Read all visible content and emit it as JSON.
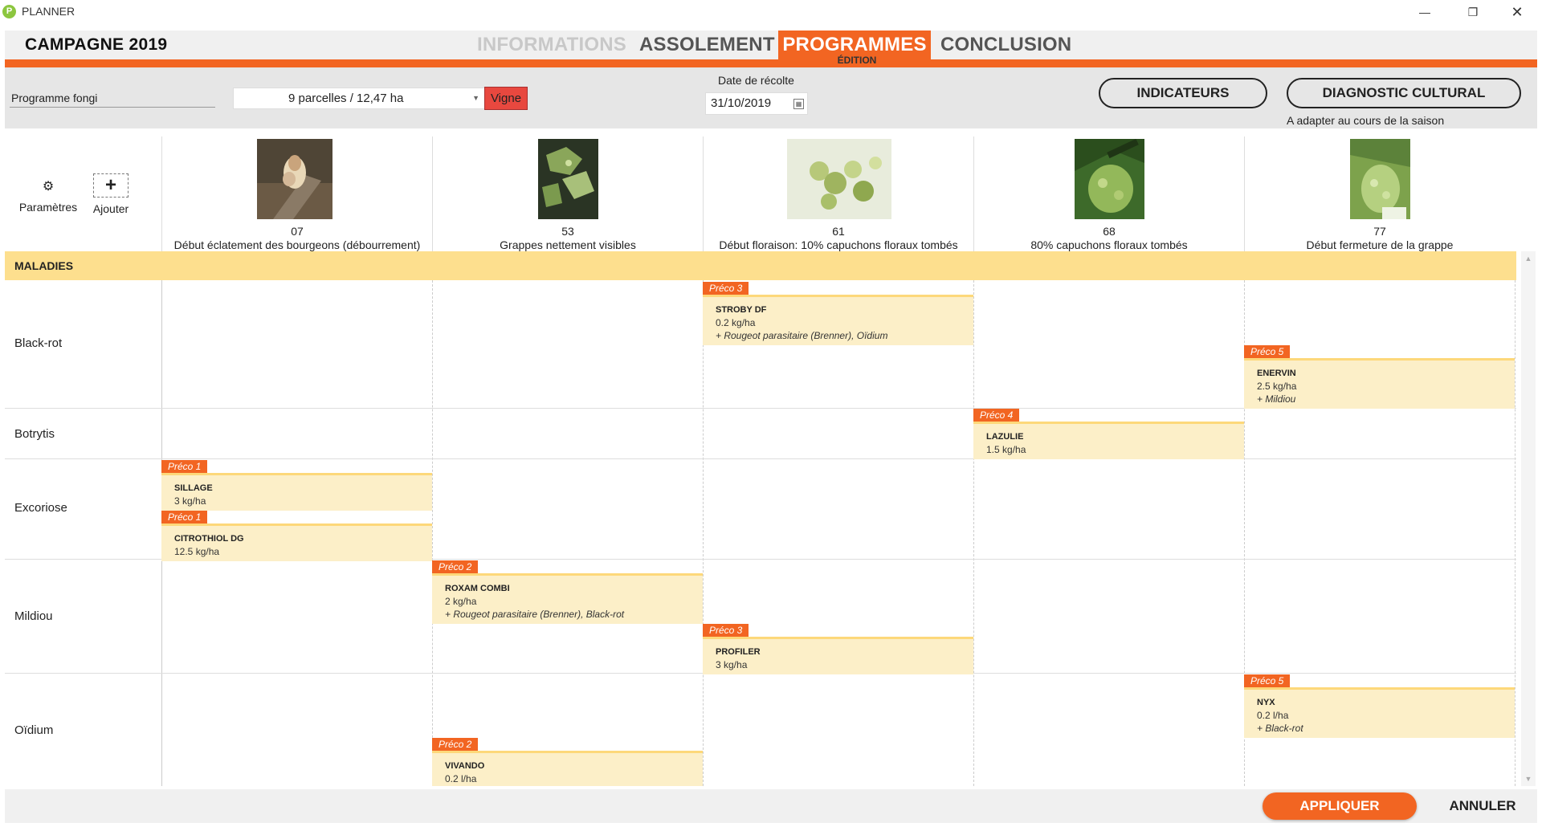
{
  "window": {
    "title": "PLANNER",
    "logo_letter": "P",
    "minimize": "—",
    "maximize": "❐",
    "close": "✕"
  },
  "header": {
    "campaign": "CAMPAGNE  2019",
    "tabs": [
      "INFORMATIONS",
      "ASSOLEMENT",
      "PROGRAMMES",
      "CONCLUSION"
    ],
    "active_tab": "PROGRAMMES",
    "subtitle": "ÉDITION"
  },
  "toolbar": {
    "program_name": "Programme fongi",
    "parcels": "9 parcelles  /  12,47   ha",
    "crop": "Vigne",
    "harvest_label": "Date de récolte",
    "harvest_date": "31/10/2019",
    "indicators_btn": "INDICATEURS",
    "diagnostic_btn": "DIAGNOSTIC CULTURAL",
    "season_note": "A adapter au cours de la saison"
  },
  "tools": {
    "params": "Paramètres",
    "add": "Ajouter"
  },
  "stages": [
    {
      "code": "07",
      "name": "Début éclatement des bourgeons (débourrement)"
    },
    {
      "code": "53",
      "name": "Grappes nettement visibles"
    },
    {
      "code": "61",
      "name": "Début floraison: 10% capuchons floraux tombés"
    },
    {
      "code": "68",
      "name": "80% capuchons floraux tombés"
    },
    {
      "code": "77",
      "name": "Début fermeture de la grappe"
    }
  ],
  "section": "MALADIES",
  "diseases": [
    "Black-rot",
    "Botrytis",
    "Excoriose",
    "Mildiou",
    "Oïdium"
  ],
  "treatments": [
    {
      "preco": "Préco 3",
      "name": "STROBY DF",
      "dose": "0.2 kg/ha",
      "extra": "+ Rougeot parasitaire (Brenner), Oïdium"
    },
    {
      "preco": "Préco 5",
      "name": "ENERVIN",
      "dose": "2.5 kg/ha",
      "extra": "+ Mildiou"
    },
    {
      "preco": "Préco 4",
      "name": "LAZULIE",
      "dose": "1.5 kg/ha",
      "extra": ""
    },
    {
      "preco": "Préco 1",
      "name": "SILLAGE",
      "dose": "3 kg/ha",
      "extra": ""
    },
    {
      "preco": "Préco 1",
      "name": "CITROTHIOL DG",
      "dose": "12.5 kg/ha",
      "extra": ""
    },
    {
      "preco": "Préco 2",
      "name": "ROXAM COMBI",
      "dose": "2 kg/ha",
      "extra": "+ Rougeot parasitaire (Brenner), Black-rot"
    },
    {
      "preco": "Préco 3",
      "name": "PROFILER",
      "dose": "3 kg/ha",
      "extra": ""
    },
    {
      "preco": "Préco 5",
      "name": "NYX",
      "dose": "0.2 l/ha",
      "extra": "+ Black-rot"
    },
    {
      "preco": "Préco 2",
      "name": "VIVANDO",
      "dose": "0.2 l/ha",
      "extra": ""
    }
  ],
  "footer": {
    "apply": "APPLIQUER",
    "cancel": "ANNULER"
  },
  "colors": {
    "accent": "#f26522",
    "section_bg": "#fddf8e",
    "treatment_bg": "#fcefc8",
    "crop_btn": "#e8483f"
  }
}
